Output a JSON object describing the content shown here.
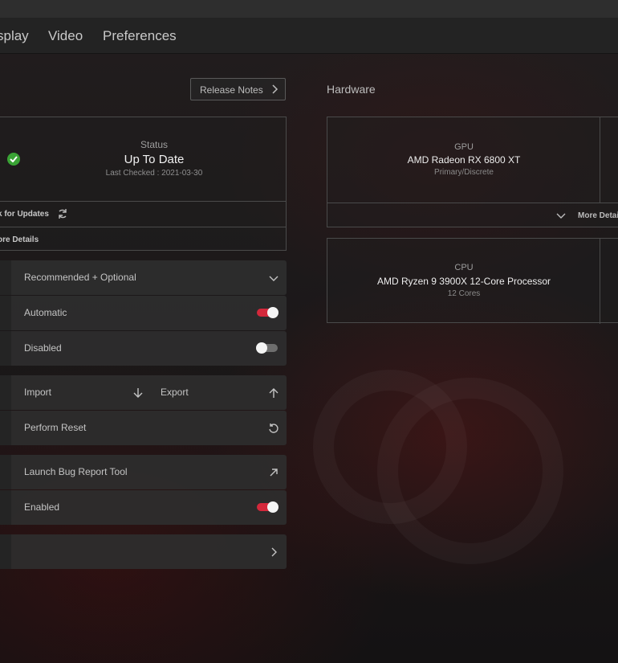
{
  "nav": {
    "items": [
      "splay",
      "Video",
      "Preferences"
    ]
  },
  "release_notes": {
    "label": "Release Notes"
  },
  "hardware": {
    "title": "Hardware"
  },
  "status": {
    "label": "Status",
    "value": "Up To Date",
    "last_checked": "Last Checked : 2021-03-30",
    "check_updates": "k for Updates",
    "more_details": "ore Details"
  },
  "gpu": {
    "label": "GPU",
    "name": "AMD Radeon RX 6800 XT",
    "sub": "Primary/Discrete",
    "more_details": "More Details"
  },
  "cpu": {
    "label": "CPU",
    "name": "AMD Ryzen 9 3900X 12-Core Processor",
    "sub": "12 Cores"
  },
  "settings": {
    "update_type": "Recommended + Optional",
    "auto_update": {
      "label": "Automatic",
      "on": true
    },
    "disabled_setting": {
      "label": "Disabled",
      "on": false
    },
    "import_label": "Import",
    "export_label": "Export",
    "reset_label": "Perform Reset",
    "bug_report_label": "Launch Bug Report Tool",
    "enabled_setting": {
      "label": "Enabled",
      "on": true
    }
  },
  "colors": {
    "accent": "#d4283b",
    "ok": "#3aa335"
  }
}
